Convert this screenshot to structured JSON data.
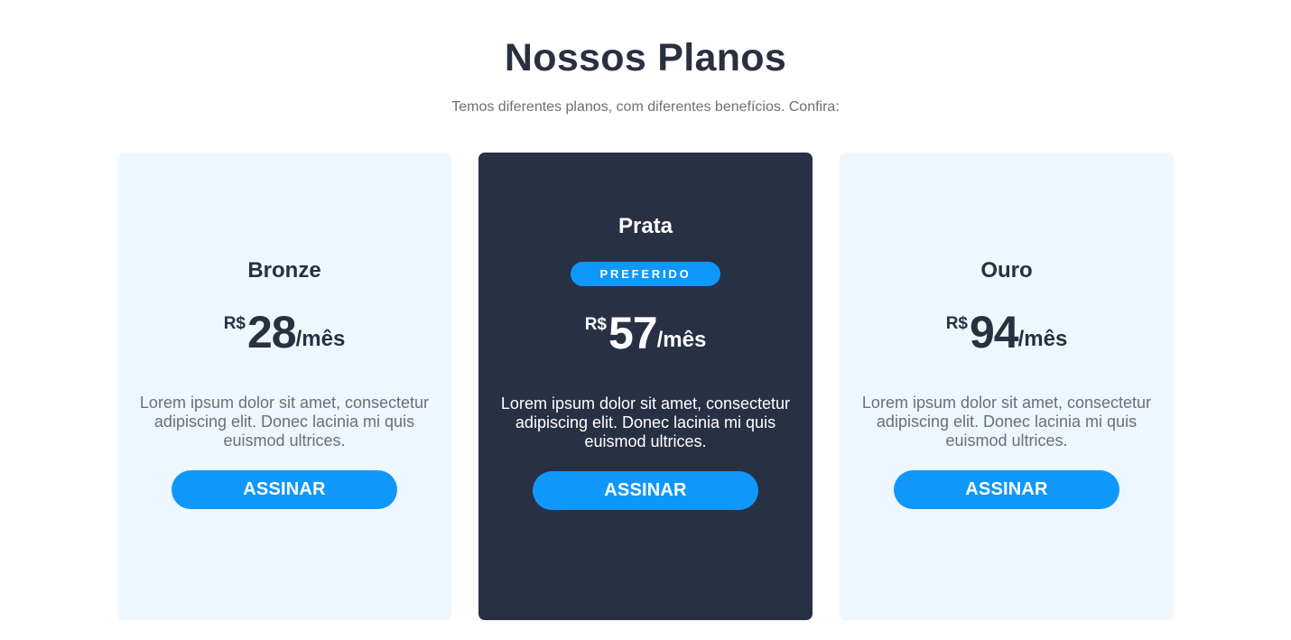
{
  "header": {
    "title": "Nossos Planos",
    "subtitle": "Temos diferentes planos, com diferentes benefícios. Confira:"
  },
  "plans": [
    {
      "name": "Bronze",
      "currency": "R$",
      "amount": "28",
      "period": "/mês",
      "description": "Lorem ipsum dolor sit amet, consectetur adipiscing elit. Donec lacinia mi quis euismod ultrices.",
      "button_label": "ASSINAR"
    },
    {
      "name": "Prata",
      "badge": "PREFERIDO",
      "currency": "R$",
      "amount": "57",
      "period": "/mês",
      "description": "Lorem ipsum dolor sit amet, consectetur adipiscing elit. Donec lacinia mi quis euismod ultrices.",
      "button_label": "ASSINAR"
    },
    {
      "name": "Ouro",
      "currency": "R$",
      "amount": "94",
      "period": "/mês",
      "description": "Lorem ipsum dolor sit amet, consectetur adipiscing elit. Donec lacinia mi quis euismod ultrices.",
      "button_label": "ASSINAR"
    }
  ],
  "colors": {
    "accent": "#1097fb",
    "dark": "#283044",
    "card_light": "#eef7fe",
    "text_dark": "#29303f",
    "text_muted": "#6b6f78"
  }
}
